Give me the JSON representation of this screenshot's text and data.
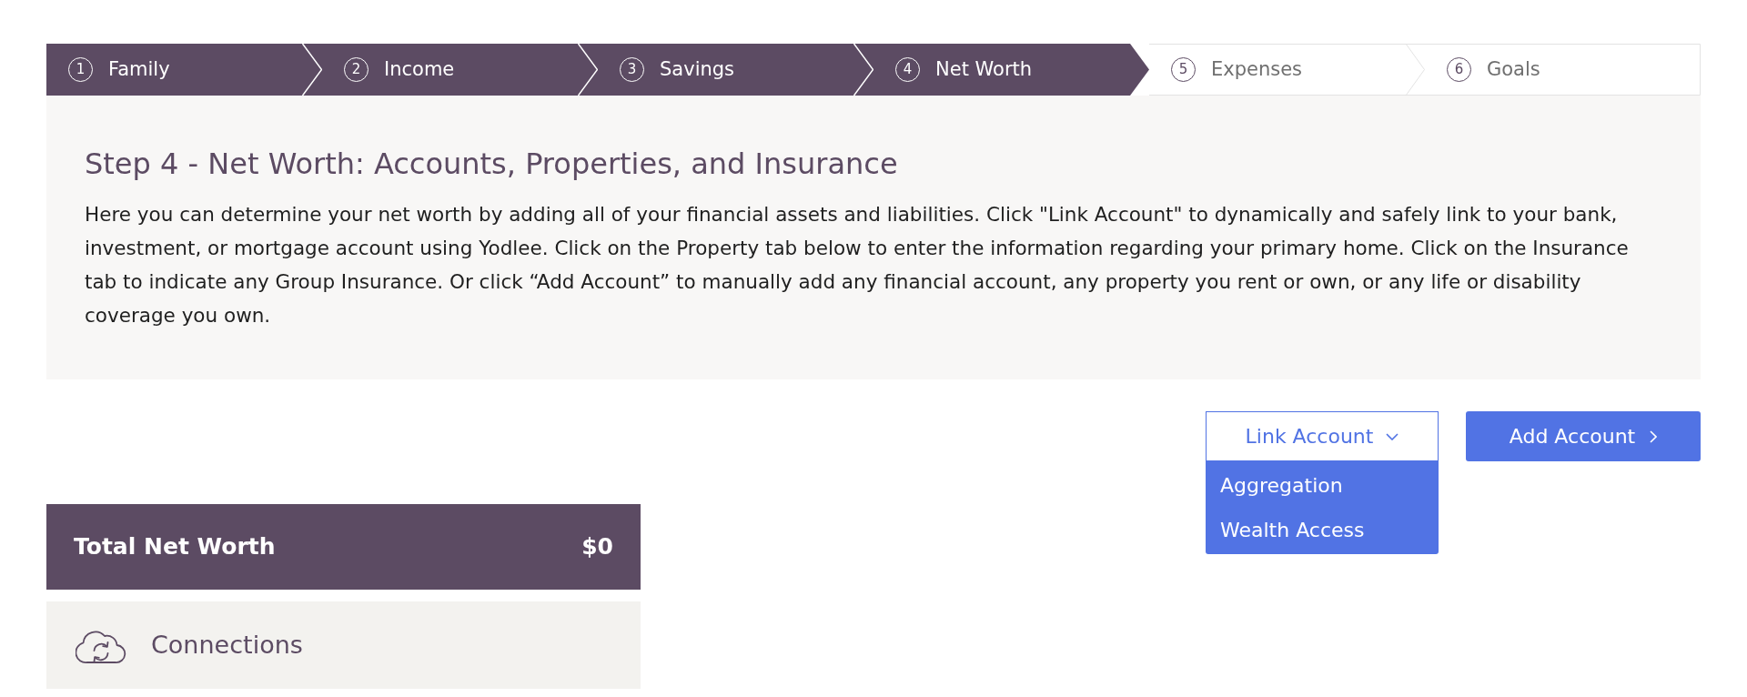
{
  "steps": [
    {
      "number": "1",
      "label": "Family",
      "selected": false
    },
    {
      "number": "2",
      "label": "Income",
      "selected": false
    },
    {
      "number": "3",
      "label": "Savings",
      "selected": false
    },
    {
      "number": "4",
      "label": "Net Worth",
      "selected": true
    },
    {
      "number": "5",
      "label": "Expenses",
      "selected": false
    },
    {
      "number": "6",
      "label": "Goals",
      "selected": false
    }
  ],
  "intro": {
    "title": "Step 4 - Net Worth: Accounts, Properties, and Insurance",
    "text": "Here you can determine your net worth by adding all of your financial assets and liabilities. Click \"Link Account\" to dynamically and safely link to your bank, investment, or mortgage account using Yodlee. Click on the Property tab below to enter the information regarding your primary home. Click on the Insurance tab to indicate any Group Insurance. Or click “Add Account” to manually add any financial account, any property you rent or own, or any life or disability coverage you own."
  },
  "actions": {
    "link_account": {
      "label": "Link Account",
      "expanded": true,
      "menu": [
        "Aggregation",
        "Wealth Access"
      ]
    },
    "add_account": {
      "label": "Add Account"
    }
  },
  "summary": {
    "label": "Total Net Worth",
    "value": "$0"
  },
  "sections": [
    {
      "label": "Connections"
    }
  ]
}
